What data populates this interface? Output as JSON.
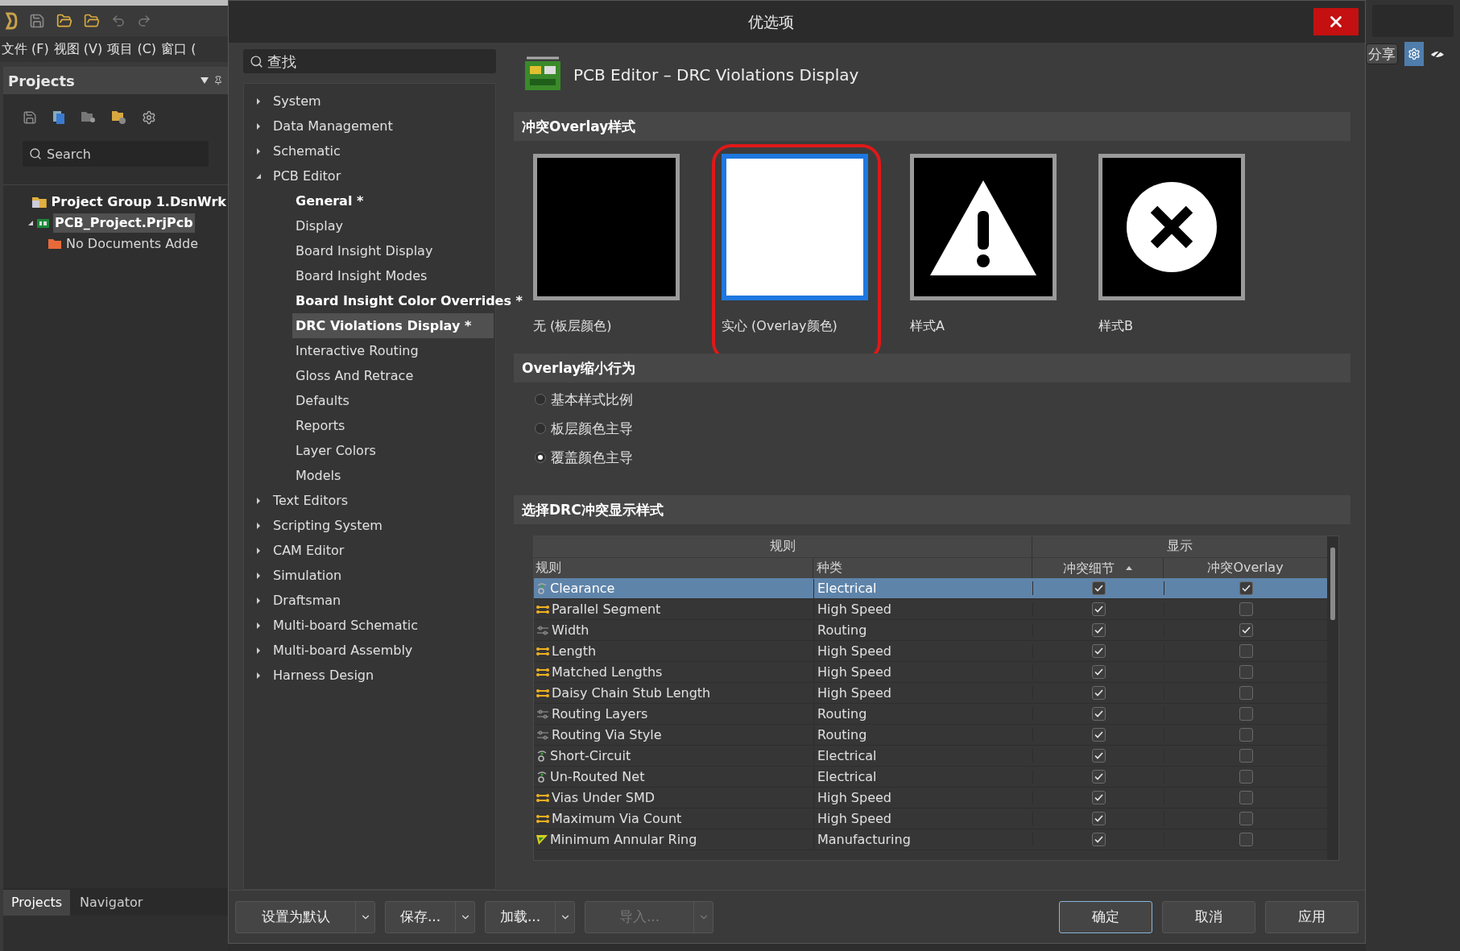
{
  "app": {
    "menu": [
      "文件 (F)",
      "视图 (V)",
      "项目 (C)",
      "窗口 ("
    ],
    "projects_panel": {
      "title": "Projects",
      "search": {
        "placeholder": "Search"
      },
      "tree": [
        {
          "label": "Project Group 1.DsnWrk",
          "kind": "group",
          "selected": false,
          "children": [
            {
              "label": "PCB_Project.PrjPcb",
              "kind": "project",
              "selected": true,
              "expanded": true,
              "children": [
                {
                  "label": "No Documents Adde",
                  "kind": "folder",
                  "selected": false
                }
              ]
            }
          ]
        }
      ],
      "tabs": [
        {
          "label": "Projects",
          "selected": true
        },
        {
          "label": "Navigator",
          "selected": false
        }
      ]
    },
    "share_button": "分享"
  },
  "dialog": {
    "title": "优选项",
    "search": {
      "placeholder": "查找"
    },
    "nav": [
      {
        "label": "System",
        "expanded": false,
        "selected": false
      },
      {
        "label": "Data Management",
        "expanded": false,
        "selected": false
      },
      {
        "label": "Schematic",
        "expanded": false,
        "selected": false
      },
      {
        "label": "PCB Editor",
        "expanded": true,
        "selected": false,
        "children": [
          {
            "label": "General *",
            "modified": true,
            "selected": false
          },
          {
            "label": "Display",
            "modified": false,
            "selected": false
          },
          {
            "label": "Board Insight Display",
            "modified": false,
            "selected": false
          },
          {
            "label": "Board Insight Modes",
            "modified": false,
            "selected": false
          },
          {
            "label": "Board Insight Color Overrides *",
            "modified": true,
            "selected": false
          },
          {
            "label": "DRC Violations Display *",
            "modified": true,
            "selected": true
          },
          {
            "label": "Interactive Routing",
            "modified": false,
            "selected": false
          },
          {
            "label": "Gloss And Retrace",
            "modified": false,
            "selected": false
          },
          {
            "label": "Defaults",
            "modified": false,
            "selected": false
          },
          {
            "label": "Reports",
            "modified": false,
            "selected": false
          },
          {
            "label": "Layer Colors",
            "modified": false,
            "selected": false
          },
          {
            "label": "Models",
            "modified": false,
            "selected": false
          }
        ]
      },
      {
        "label": "Text Editors",
        "expanded": false,
        "selected": false
      },
      {
        "label": "Scripting System",
        "expanded": false,
        "selected": false
      },
      {
        "label": "CAM Editor",
        "expanded": false,
        "selected": false
      },
      {
        "label": "Simulation",
        "expanded": false,
        "selected": false
      },
      {
        "label": "Draftsman",
        "expanded": false,
        "selected": false
      },
      {
        "label": "Multi-board Schematic",
        "expanded": false,
        "selected": false
      },
      {
        "label": "Multi-board Assembly",
        "expanded": false,
        "selected": false
      },
      {
        "label": "Harness Design",
        "expanded": false,
        "selected": false
      }
    ],
    "page_title": "PCB Editor – DRC Violations Display",
    "overlay_style": {
      "heading": "冲突Overlay样式",
      "options": [
        {
          "label": "无 (板层颜色)",
          "kind": "none",
          "selected": false,
          "annotated": false
        },
        {
          "label": "实心 (Overlay颜色)",
          "kind": "solid",
          "selected": true,
          "annotated": true
        },
        {
          "label": "样式A",
          "kind": "warning",
          "selected": false,
          "annotated": false
        },
        {
          "label": "样式B",
          "kind": "cross",
          "selected": false,
          "annotated": false
        }
      ]
    },
    "zoom_behavior": {
      "heading": "Overlay缩小行为",
      "options": [
        {
          "label": "基本样式比例",
          "selected": false
        },
        {
          "label": "板层颜色主导",
          "selected": false
        },
        {
          "label": "覆盖颜色主导",
          "selected": true
        }
      ]
    },
    "drc_table": {
      "heading": "选择DRC冲突显示样式",
      "groups": [
        "规则",
        "显示"
      ],
      "columns": [
        "规则",
        "种类",
        "冲突细节",
        "冲突Overlay"
      ],
      "rows": [
        {
          "rule": "Clearance",
          "type": "Electrical",
          "kind": "electrical",
          "detail": true,
          "overlay": true,
          "selected": true
        },
        {
          "rule": "Parallel Segment",
          "type": "High Speed",
          "kind": "speed",
          "detail": true,
          "overlay": false,
          "selected": false
        },
        {
          "rule": "Width",
          "type": "Routing",
          "kind": "routing",
          "detail": true,
          "overlay": true,
          "selected": false
        },
        {
          "rule": "Length",
          "type": "High Speed",
          "kind": "speed",
          "detail": true,
          "overlay": false,
          "selected": false
        },
        {
          "rule": "Matched Lengths",
          "type": "High Speed",
          "kind": "speed",
          "detail": true,
          "overlay": false,
          "selected": false
        },
        {
          "rule": "Daisy Chain Stub Length",
          "type": "High Speed",
          "kind": "speed",
          "detail": true,
          "overlay": false,
          "selected": false
        },
        {
          "rule": "Routing Layers",
          "type": "Routing",
          "kind": "routing",
          "detail": true,
          "overlay": false,
          "selected": false
        },
        {
          "rule": "Routing Via Style",
          "type": "Routing",
          "kind": "routing",
          "detail": true,
          "overlay": false,
          "selected": false
        },
        {
          "rule": "Short-Circuit",
          "type": "Electrical",
          "kind": "electrical",
          "detail": true,
          "overlay": false,
          "selected": false
        },
        {
          "rule": "Un-Routed Net",
          "type": "Electrical",
          "kind": "electrical",
          "detail": true,
          "overlay": false,
          "selected": false
        },
        {
          "rule": "Vias Under SMD",
          "type": "High Speed",
          "kind": "speed",
          "detail": true,
          "overlay": false,
          "selected": false
        },
        {
          "rule": "Maximum Via Count",
          "type": "High Speed",
          "kind": "speed",
          "detail": true,
          "overlay": false,
          "selected": false
        },
        {
          "rule": "Minimum Annular Ring",
          "type": "Manufacturing",
          "kind": "manufacturing",
          "detail": true,
          "overlay": false,
          "selected": false
        }
      ]
    },
    "buttons": [
      {
        "label": "设置为默认",
        "dropdown": true,
        "disabled": false,
        "default": false
      },
      {
        "label": "保存...",
        "dropdown": true,
        "disabled": false,
        "default": false
      },
      {
        "label": "加载...",
        "dropdown": true,
        "disabled": false,
        "default": false
      },
      {
        "label": "导入...",
        "dropdown": true,
        "disabled": true,
        "default": false
      },
      {
        "label": "确定",
        "dropdown": false,
        "disabled": false,
        "default": true
      },
      {
        "label": "取消",
        "dropdown": false,
        "disabled": false,
        "default": false
      },
      {
        "label": "应用",
        "dropdown": false,
        "disabled": false,
        "default": false
      }
    ]
  }
}
